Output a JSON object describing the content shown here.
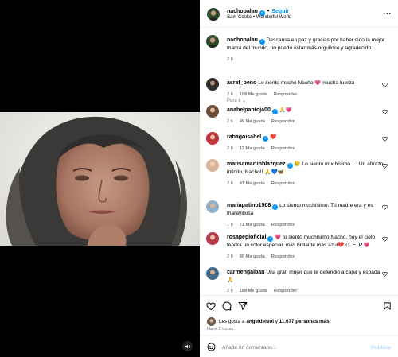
{
  "post": {
    "author": "nachopalau",
    "follow_label": "Seguir",
    "dot": "•",
    "audio": "Sam Cooke • Wonderful World",
    "caption": "Descansa en paz y gracias por haber sido la mejor mamá del mundo, no puedo estar más orgulloso y agradecido.",
    "caption_time": "2 h",
    "sort_label": "Para ti ⌄"
  },
  "comments": [
    {
      "user": "asraf_beno",
      "verified": false,
      "text": "Lo siento mucho Nacho 💗 mucha fuerza",
      "time": "2 h",
      "likes": "108 Me gusta",
      "reply": "Responder"
    },
    {
      "user": "anabelpantoja00",
      "verified": true,
      "text": "🙏💗",
      "time": "2 h",
      "likes": "49 Me gusta",
      "reply": "Responder"
    },
    {
      "user": "rabagoisabel",
      "verified": true,
      "text": "❤️",
      "time": "2 h",
      "likes": "13 Me gusta",
      "reply": "Responder"
    },
    {
      "user": "marisamartinblazquez",
      "verified": true,
      "text": "😢 Lo siento muchísimo....! Un abrazo infinito, Nacho!! 🙏💙🦋",
      "time": "2 h",
      "likes": "41 Me gusta",
      "reply": "Responder"
    },
    {
      "user": "mariapatino1508",
      "verified": true,
      "text": "Lo siento muchísimo. Tú madre era y es maravillosa",
      "time": "1 h",
      "likes": "71 Me gusta",
      "reply": "Responder"
    },
    {
      "user": "rosapepioficial",
      "verified": true,
      "text": "💗 lo siento muchísimo Nacho, hoy el cielo tendrá un color especial, más brillante más azul💔 D. E. P 💗",
      "time": "2 h",
      "likes": "90 Me gusta",
      "reply": "Responder"
    },
    {
      "user": "carmengalban",
      "verified": false,
      "text": "Una gran mujer que te defendió a capa y espada🙏",
      "time": "2 h",
      "likes": "168 Me gusta",
      "reply": "Responder"
    }
  ],
  "likes": {
    "prefix": "Les gusta a ",
    "user": "angeldelsol",
    "middle": " y ",
    "count": "11.677 personas más"
  },
  "posted_ago": "Hace 2 horas",
  "add_comment": {
    "placeholder": "Añade un comentario...",
    "publish": "Publicar"
  },
  "colors": {
    "accent": "#0095f6",
    "muted": "#737373",
    "like_red": "#ff3040"
  }
}
